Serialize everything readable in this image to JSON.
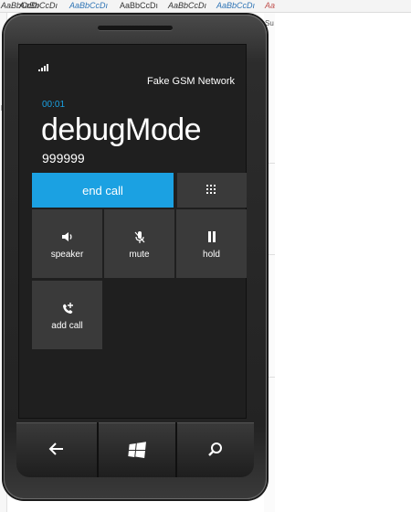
{
  "document_background": {
    "style_gallery": [
      "AaBbCcDı",
      "AaBbCcDı",
      "AaBbCcDı",
      "AaBbCcDı",
      "AaBbCcDı",
      "AaBbCcDı",
      "Aa"
    ],
    "right_edge_text": "Su",
    "left_edge_marks": "ll"
  },
  "status_bar": {
    "signal_icon": "signal-strength-icon",
    "network": "Fake GSM Network"
  },
  "call": {
    "timer": "00:01",
    "caller_name": "debugMode",
    "caller_number": "999999"
  },
  "buttons": {
    "end_call": "end call",
    "keypad_icon": "keypad-icon",
    "speaker": "speaker",
    "mute": "mute",
    "hold": "hold",
    "add_call": "add call"
  },
  "hardware_keys": {
    "back_icon": "back-arrow-icon",
    "start_icon": "windows-logo-icon",
    "search_icon": "search-icon"
  },
  "colors": {
    "accent": "#1ba1e2",
    "tile": "#3a3a3a",
    "screen": "#1f1f1f"
  }
}
